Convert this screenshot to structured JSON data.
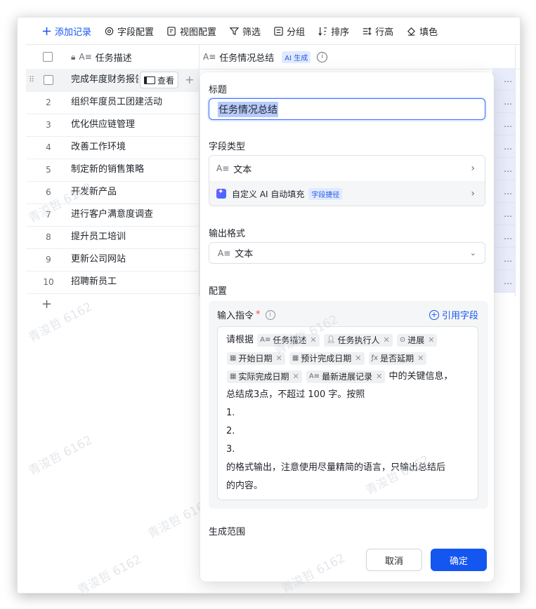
{
  "toolbar": {
    "items": [
      {
        "label": "添加记录",
        "icon": "plus-icon"
      },
      {
        "label": "字段配置",
        "icon": "gear-icon"
      },
      {
        "label": "视图配置",
        "icon": "view-config-icon"
      },
      {
        "label": "筛选",
        "icon": "filter-icon"
      },
      {
        "label": "分组",
        "icon": "group-icon"
      },
      {
        "label": "排序",
        "icon": "sort-icon"
      },
      {
        "label": "行高",
        "icon": "row-height-icon"
      },
      {
        "label": "填色",
        "icon": "fill-color-icon"
      }
    ]
  },
  "table": {
    "col1_header": "任务描述",
    "col2_header": "任务情况总结",
    "col2_badge": "AI 生成",
    "rows": [
      {
        "num": "",
        "text": "完成年度财务报告"
      },
      {
        "num": "2",
        "text": "组织年度员工团建活动"
      },
      {
        "num": "3",
        "text": "优化供应链管理"
      },
      {
        "num": "4",
        "text": "改善工作环境"
      },
      {
        "num": "5",
        "text": "制定新的销售策略"
      },
      {
        "num": "6",
        "text": "开发新产品"
      },
      {
        "num": "7",
        "text": "进行客户满意度调查"
      },
      {
        "num": "8",
        "text": "提升员工培训"
      },
      {
        "num": "9",
        "text": "更新公司网站"
      },
      {
        "num": "10",
        "text": "招聘新员工"
      }
    ],
    "view_button": "查看",
    "ellipsis": "…"
  },
  "panel": {
    "title_label": "标题",
    "title_value": "任务情况总结",
    "field_type_label": "字段类型",
    "field_type_value": "文本",
    "ai_fill_label": "自定义 AI 自动填充",
    "ai_fill_badge": "字段捷径",
    "output_format_label": "输出格式",
    "output_format_value": "文本",
    "config_label": "配置",
    "instruction_label": "输入指令",
    "required_mark": "*",
    "ref_field_button": "引用字段",
    "prompt": {
      "prefix": "请根据",
      "tags": [
        "任务描述",
        "任务执行人",
        "进展",
        "开始日期",
        "预计完成日期",
        "是否延期",
        "实际完成日期",
        "最新进展记录"
      ],
      "after_tags": "中的关键信息，",
      "line2": "总结成3点，不超过 100 字。按照",
      "line3": "1.",
      "line4": "2.",
      "line5": "3.",
      "line6": "的格式输出，注意使用尽量精简的语言，只输出总结后",
      "line7": "的内容。"
    },
    "range_label": "生成范围",
    "cancel": "取消",
    "confirm": "确定"
  },
  "watermark": "青浚哲 6162",
  "colors": {
    "accent": "#1456f0",
    "ai_badge_bg": "#e1eaff"
  }
}
